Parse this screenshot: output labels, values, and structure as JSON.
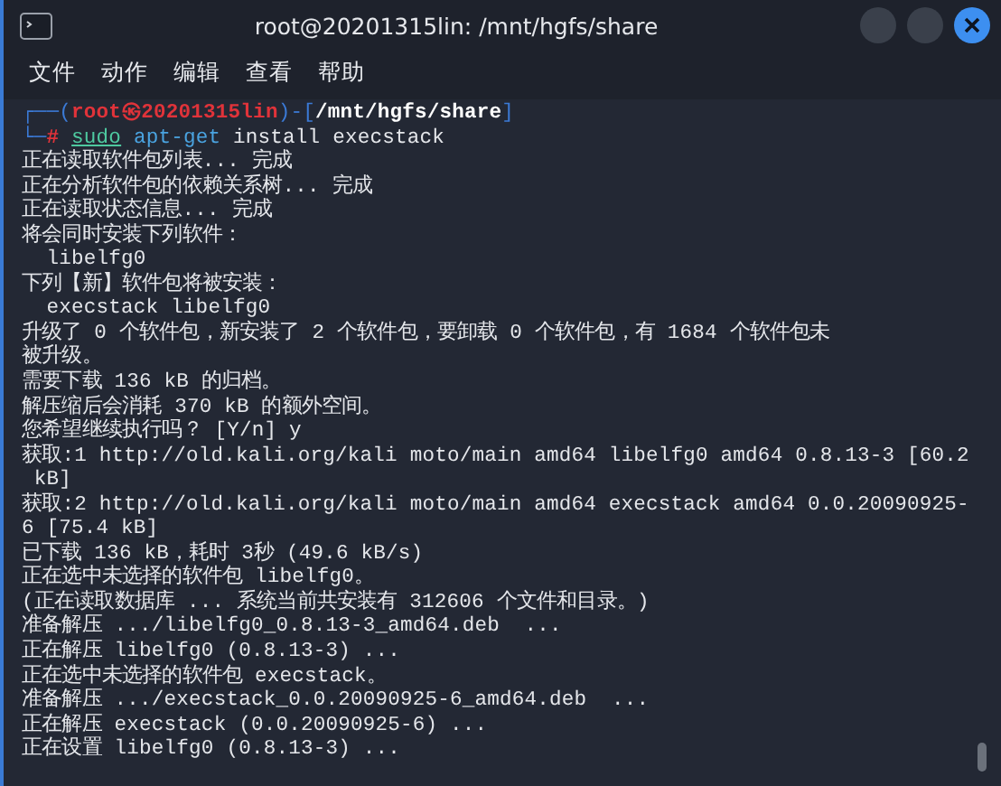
{
  "window": {
    "title": "root@20201315lin: /mnt/hgfs/share"
  },
  "menu": [
    "文件",
    "动作",
    "编辑",
    "查看",
    "帮助"
  ],
  "prompt": {
    "open": "┌──(",
    "user": "root㉿20201315lin",
    "mid": ")-[",
    "path": "/mnt/hgfs/share",
    "close": "]",
    "corner": "└─",
    "symbol": "#"
  },
  "command": [
    {
      "text": "sudo",
      "kind": "builtin"
    },
    {
      "text": "apt-get",
      "kind": "program"
    },
    {
      "text": "install",
      "kind": "arg"
    },
    {
      "text": "execstack",
      "kind": "arg"
    }
  ],
  "output": [
    "正在读取软件包列表... 完成",
    "正在分析软件包的依赖关系树... 完成",
    "正在读取状态信息... 完成",
    "将会同时安装下列软件：",
    "  libelfg0",
    "下列【新】软件包将被安装：",
    "  execstack libelfg0",
    "升级了 0 个软件包，新安装了 2 个软件包，要卸载 0 个软件包，有 1684 个软件包未",
    "被升级。",
    "需要下载 136 kB 的归档。",
    "解压缩后会消耗 370 kB 的额外空间。",
    "您希望继续执行吗？ [Y/n] y",
    "获取:1 http://old.kali.org/kali moto/main amd64 libelfg0 amd64 0.8.13-3 [60.2",
    " kB]",
    "获取:2 http://old.kali.org/kali moto/main amd64 execstack amd64 0.0.20090925-",
    "6 [75.4 kB]",
    "已下载 136 kB，耗时 3秒 (49.6 kB/s)",
    "正在选中未选择的软件包 libelfg0。",
    "(正在读取数据库 ... 系统当前共安装有 312606 个文件和目录。)",
    "准备解压 .../libelfg0_0.8.13-3_amd64.deb  ...",
    "正在解压 libelfg0 (0.8.13-3) ...",
    "正在选中未选择的软件包 execstack。",
    "准备解压 .../execstack_0.0.20090925-6_amd64.deb  ...",
    "正在解压 execstack (0.0.20090925-6) ...",
    "正在设置 libelfg0 (0.8.13-3) ..."
  ]
}
